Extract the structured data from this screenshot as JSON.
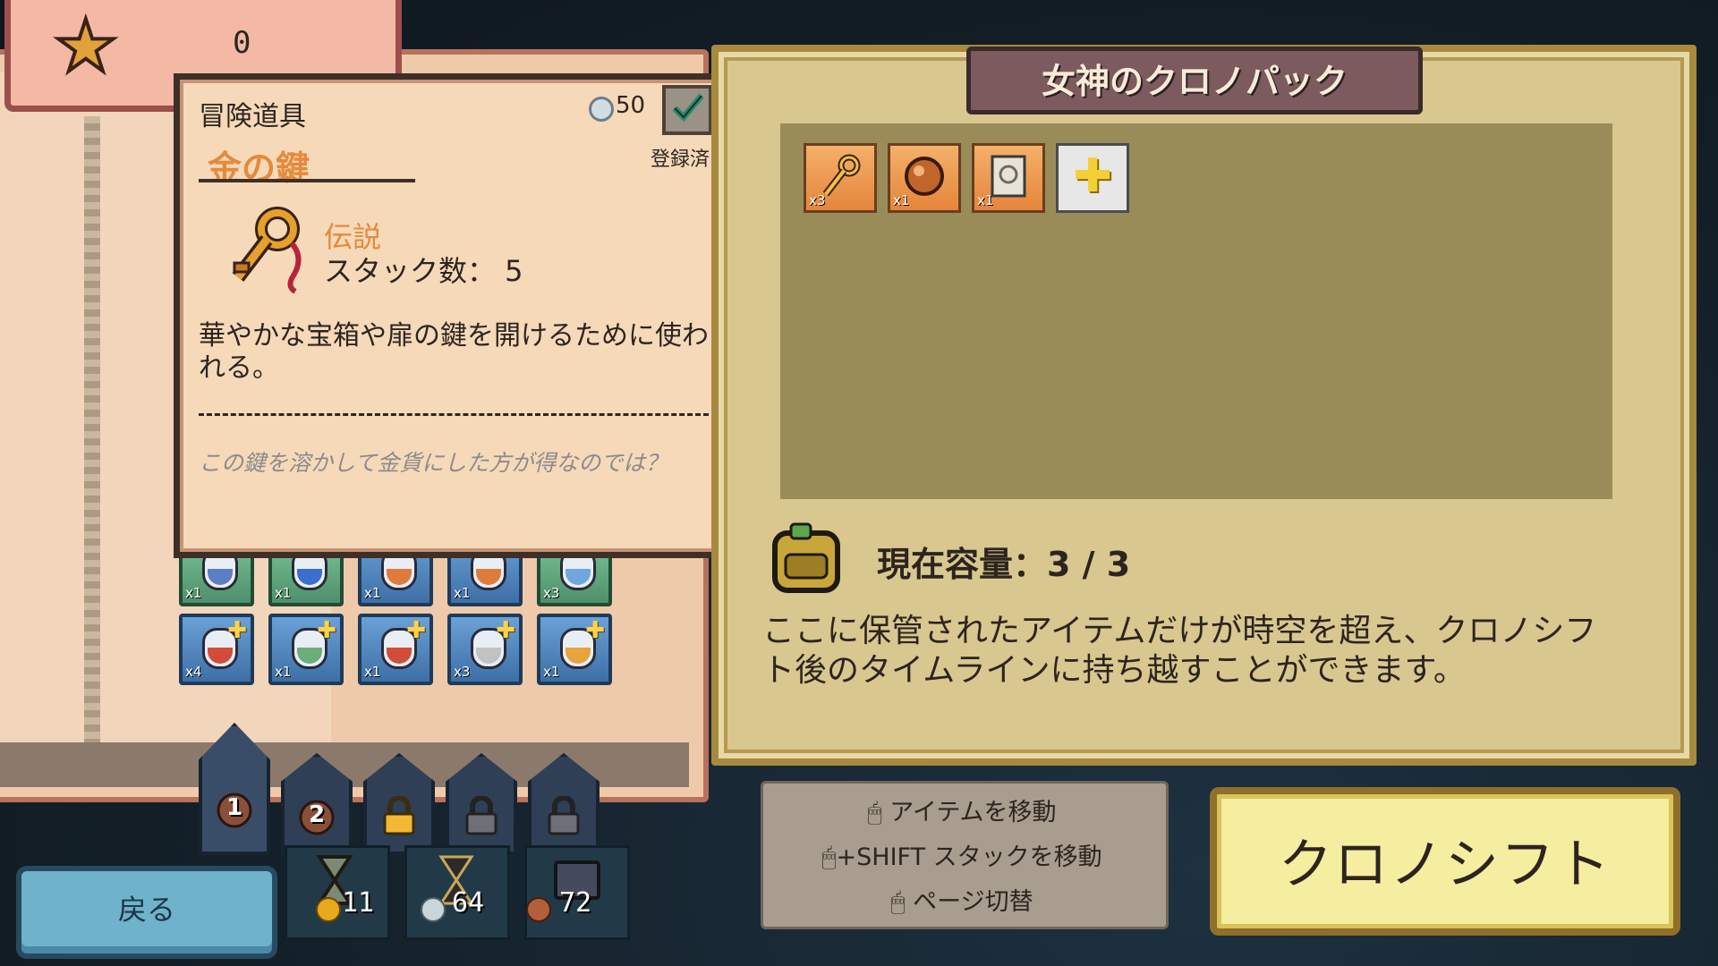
{
  "score": {
    "value": "0",
    "icon": "star-icon"
  },
  "item_card": {
    "category": "冒険道具",
    "cost": "50",
    "registered_label": "登録済",
    "name": "金の鍵",
    "rarity": "伝説",
    "stack_label": "スタック数： 5",
    "description": "華やかな宝箱や扉の鍵を開けるために使われる。",
    "flavor": "この鍵を溶かして金貨にした方が得なのでは？"
  },
  "inventory": {
    "row1": [
      {
        "count": "x1",
        "liquid": "#5b7ec7",
        "color": "green"
      },
      {
        "count": "x1",
        "liquid": "#3a6fd0",
        "color": "green"
      },
      {
        "count": "x1",
        "liquid": "#e07b3b",
        "color": "blue"
      },
      {
        "count": "x1",
        "liquid": "#e07b3b",
        "color": "blue"
      },
      {
        "count": "x3",
        "liquid": "#6fa7de",
        "color": "green"
      }
    ],
    "row2": [
      {
        "count": "x4",
        "liquid": "#d24c3a"
      },
      {
        "count": "x1",
        "liquid": "#6cae7a"
      },
      {
        "count": "x1",
        "liquid": "#d24c3a"
      },
      {
        "count": "x3",
        "liquid": "#c2c2c2"
      },
      {
        "count": "x1",
        "liquid": "#e8a33a"
      }
    ]
  },
  "page_tabs": [
    {
      "label": "1",
      "icon": "bag-icon",
      "locked": false
    },
    {
      "label": "2",
      "icon": "bag-icon",
      "locked": false
    },
    {
      "label": "",
      "icon": "lock-icon",
      "locked": true
    },
    {
      "label": "",
      "icon": "lock-icon",
      "locked": true
    },
    {
      "label": "",
      "icon": "lock-icon",
      "locked": true
    }
  ],
  "bottom_bar": {
    "back_label": "戻る",
    "resources": [
      {
        "icon": "hourglass-icon",
        "value": "11",
        "coin": "#e8a91d"
      },
      {
        "icon": "hourglass-dark-icon",
        "value": "64",
        "coin": "#c8d6dc"
      },
      {
        "icon": "book-icon",
        "value": "72",
        "coin": "#b3603a"
      }
    ]
  },
  "chrono_pack": {
    "title": "女神のクロノパック",
    "slots": [
      {
        "icon": "key-icon",
        "count": "x3"
      },
      {
        "icon": "orb-icon",
        "count": "x1"
      },
      {
        "icon": "scroll-icon",
        "count": "x1"
      }
    ],
    "add_icon": "plus-icon",
    "capacity_label": "現在容量：3 / 3",
    "info": "ここに保管されたアイテムだけが時空を超え、クロノシフト後のタイムラインに持ち越すことができます。"
  },
  "controls": {
    "move_item": "アイテムを移動",
    "move_stack": "+SHIFT スタックを移動",
    "switch_page": "ページ切替"
  },
  "chrono_button": {
    "label": "クロノシフト"
  },
  "colors": {
    "accent_orange": "#e58a3c",
    "panel_bg": "#d8c78f",
    "slot_blue": "#6aa1d6"
  }
}
